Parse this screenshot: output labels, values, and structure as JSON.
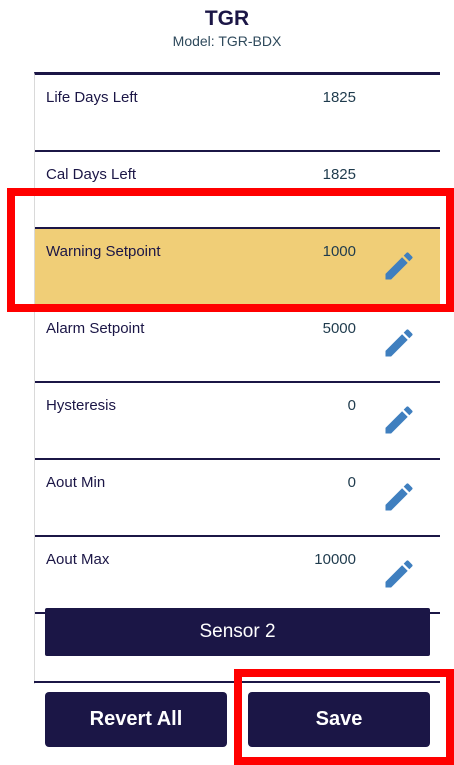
{
  "header": {
    "title": "TGR",
    "subtitle": "Model: TGR-BDX"
  },
  "rows": [
    {
      "label": "Life Days Left",
      "value": "1825",
      "editable": false,
      "highlighted": false
    },
    {
      "label": "Cal Days Left",
      "value": "1825",
      "editable": false,
      "highlighted": false
    },
    {
      "label": "Warning Setpoint",
      "value": "1000",
      "editable": true,
      "highlighted": true
    },
    {
      "label": "Alarm Setpoint",
      "value": "5000",
      "editable": true,
      "highlighted": false
    },
    {
      "label": "Hysteresis",
      "value": "0",
      "editable": true,
      "highlighted": false
    },
    {
      "label": "Aout Min",
      "value": "0",
      "editable": true,
      "highlighted": false
    },
    {
      "label": "Aout Max",
      "value": "10000",
      "editable": true,
      "highlighted": false
    }
  ],
  "sensor_button": {
    "label": "Sensor 2"
  },
  "actions": {
    "revert_label": "Revert All",
    "save_label": "Save"
  },
  "icons": {
    "edit": "pencil-icon"
  },
  "colors": {
    "primary": "#1b1646",
    "highlight": "#f0ce77",
    "pencil": "#3f7fbf",
    "annotation": "#ff0000"
  }
}
